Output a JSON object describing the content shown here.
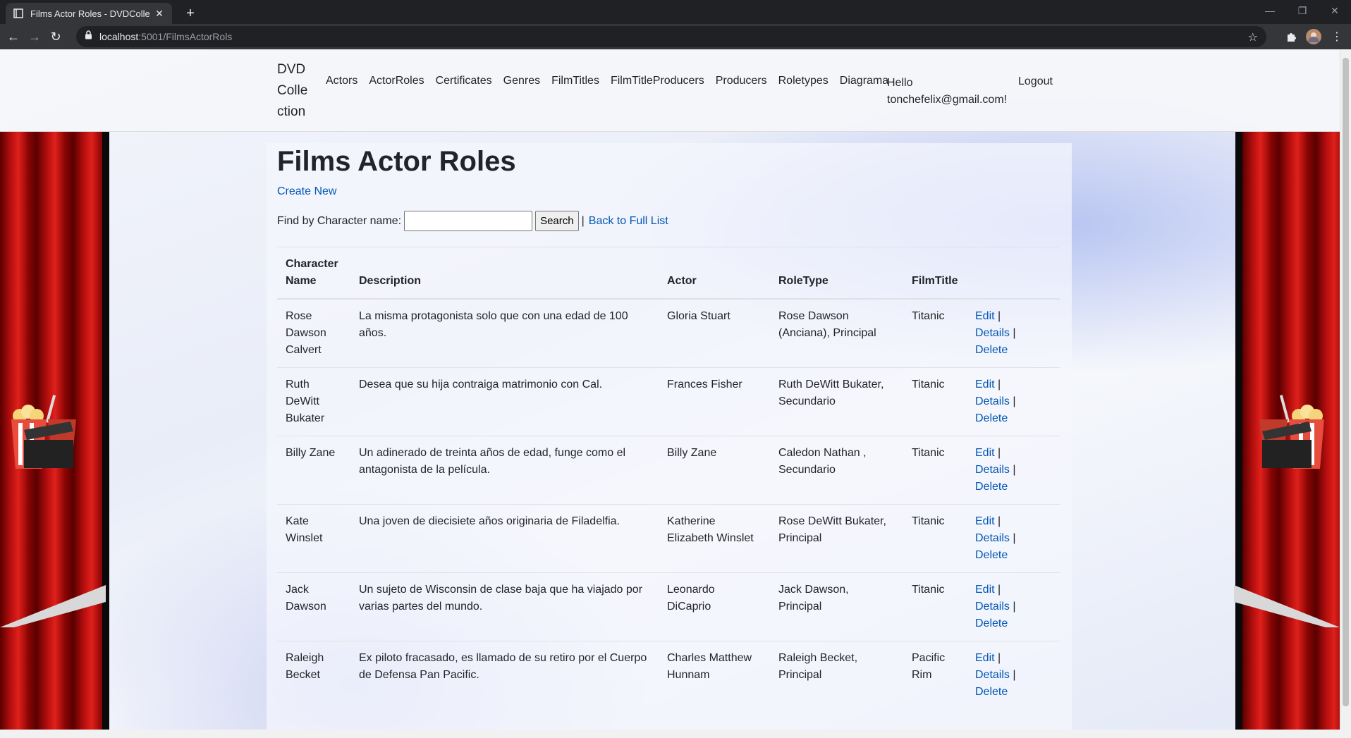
{
  "browser": {
    "tab_title": "Films Actor Roles - DVDCollection",
    "url_host": "localhost",
    "url_path": ":5001/FilmsActorRols"
  },
  "navbar": {
    "brand": "DVD Colle ction",
    "links": [
      "Actors",
      "ActorRoles",
      "Certificates",
      "Genres",
      "FilmTitles",
      "FilmTitleProducers",
      "Producers",
      "Roletypes",
      "Diagrama"
    ],
    "hello_line1": "Hello",
    "hello_line2": "tonchefelix@gmail.com!",
    "logout": "Logout"
  },
  "main": {
    "title": "Films Actor Roles",
    "create_new": "Create New",
    "search_label": "Find by Character name:",
    "search_value": "",
    "search_button": "Search",
    "separator": "|",
    "back_link": "Back to Full List",
    "table": {
      "headers": [
        "Character Name",
        "Description",
        "Actor",
        "RoleType",
        "FilmTitle",
        ""
      ],
      "rows": [
        {
          "character": "Rose Dawson Calvert",
          "description": "La misma protagonista solo que con una edad de 100 años.",
          "actor": "Gloria Stuart",
          "roletype": "Rose Dawson (Anciana), Principal",
          "film": "Titanic"
        },
        {
          "character": "Ruth DeWitt Bukater",
          "description": "Desea que su hija contraiga matrimonio con Cal.",
          "actor": "Frances Fisher",
          "roletype": "Ruth DeWitt Bukater, Secundario",
          "film": "Titanic"
        },
        {
          "character": "Billy Zane",
          "description": "Un adinerado de treinta años de edad, funge como el antagonista de la película.",
          "actor": "Billy Zane",
          "roletype": "Caledon Nathan , Secundario",
          "film": "Titanic"
        },
        {
          "character": "Kate Winslet",
          "description": "Una joven de diecisiete años originaria de Filadelfia.",
          "actor": "Katherine Elizabeth Winslet",
          "roletype": "Rose DeWitt Bukater, Principal",
          "film": "Titanic"
        },
        {
          "character": "Jack Dawson",
          "description": "Un sujeto de Wisconsin de clase baja que ha viajado por varias partes del mundo.",
          "actor": "Leonardo DiCaprio",
          "roletype": "Jack Dawson, Principal",
          "film": "Titanic"
        },
        {
          "character": "Raleigh Becket",
          "description": "Ex piloto fracasado, es llamado de su retiro por el Cuerpo de Defensa Pan Pacific.",
          "actor": "Charles Matthew Hunnam",
          "roletype": "Raleigh Becket, Principal",
          "film": "Pacific Rim"
        }
      ],
      "actions": {
        "edit": "Edit",
        "details": "Details",
        "delete": "Delete",
        "sep": "|"
      }
    }
  },
  "colors": {
    "link": "#0056b3",
    "curtain": "#c8120f",
    "chrome_dark": "#202124"
  }
}
